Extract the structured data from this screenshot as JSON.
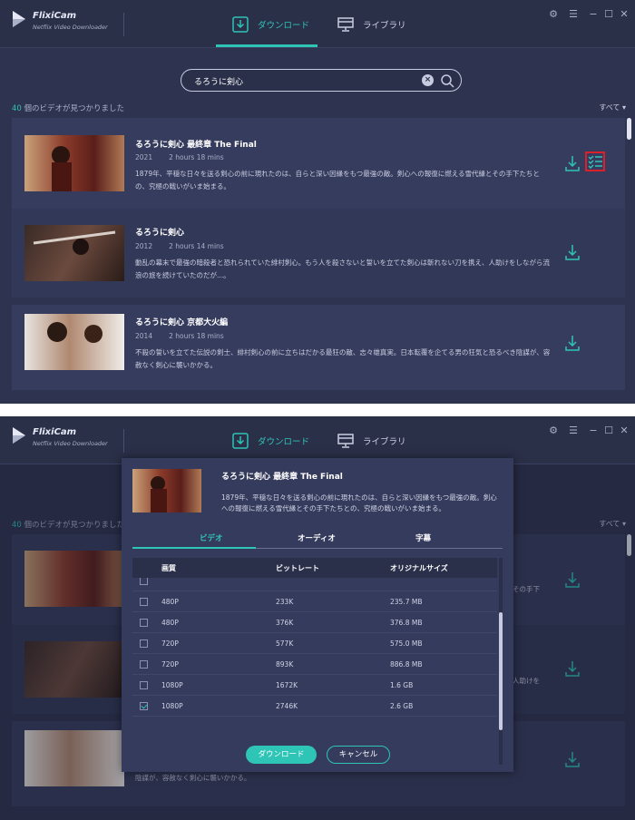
{
  "app": {
    "name": "FlixiCam",
    "subtitle": "Netflix Video Downloader"
  },
  "tabs": {
    "download": "ダウンロード",
    "library": "ライブラリ"
  },
  "search": {
    "query": "るろうに剣心"
  },
  "results": {
    "count": "40",
    "count_suffix": " 個のビデオが見つかりました",
    "filter": "すべて"
  },
  "videos": [
    {
      "title": "るろうに剣心 最終章 The Final",
      "year": "2021",
      "duration": "2 hours 18 mins",
      "desc": "1879年、平穏な日々を送る剣心の前に現れたのは、自らと深い因縁をもつ最強の敵。剣心への報復に燃える雪代縁とその手下たちとの、究極の戦いがいま始まる。",
      "thumb_text": "るろうに剣心 最終章 The Final"
    },
    {
      "title": "るろうに剣心",
      "year": "2012",
      "duration": "2 hours 14 mins",
      "desc": "動乱の幕末で最強の暗殺者と恐れられていた緋村剣心。もう人を殺さないと誓いを立てた剣心は斬れない刀を携え、人助けをしながら流浪の旅を続けていたのだが...。",
      "thumb_text": "るろうに剣心"
    },
    {
      "title": "るろうに剣心 京都大火編",
      "year": "2014",
      "duration": "2 hours 18 mins",
      "desc": "不殺の誓いを立てた伝説の剣士、緋村剣心の前に立ちはだかる最狂の敵、志々雄真実。日本転覆を企てる男の狂気と恐るべき陰謀が、容赦なく剣心に襲いかかる。",
      "thumb_text": "るろうに剣心 京都大火編"
    }
  ],
  "background_fragments": {
    "item1": "その手下",
    "item2": "人助けを",
    "item3": "陰謀が、容赦なく剣心に襲いかかる。"
  },
  "dialog": {
    "title": "るろうに剣心 最終章 The Final",
    "desc": "1879年、平穏な日々を送る剣心の前に現れたのは、自らと深い因縁をもつ最強の敵。剣心への報復に燃える雪代縁とその手下たちとの、究極の戦いがいま始まる。",
    "tabs": [
      "ビデオ",
      "オーディオ",
      "字幕"
    ],
    "columns": [
      "画質",
      "ビットレート",
      "オリジナルサイズ"
    ],
    "rows": [
      {
        "quality": "480P",
        "bitrate": "233K",
        "size": "235.7 MB",
        "checked": false
      },
      {
        "quality": "480P",
        "bitrate": "376K",
        "size": "376.8 MB",
        "checked": false
      },
      {
        "quality": "720P",
        "bitrate": "577K",
        "size": "575.0 MB",
        "checked": false
      },
      {
        "quality": "720P",
        "bitrate": "893K",
        "size": "886.8 MB",
        "checked": false
      },
      {
        "quality": "1080P",
        "bitrate": "1672K",
        "size": "1.6 GB",
        "checked": false
      },
      {
        "quality": "1080P",
        "bitrate": "2746K",
        "size": "2.6 GB",
        "checked": true
      }
    ],
    "download_label": "ダウンロード",
    "cancel_label": "キャンセル"
  },
  "colors": {
    "accent": "#2ec4b6",
    "bg": "#2e3350",
    "highlight": "#d9202c"
  }
}
